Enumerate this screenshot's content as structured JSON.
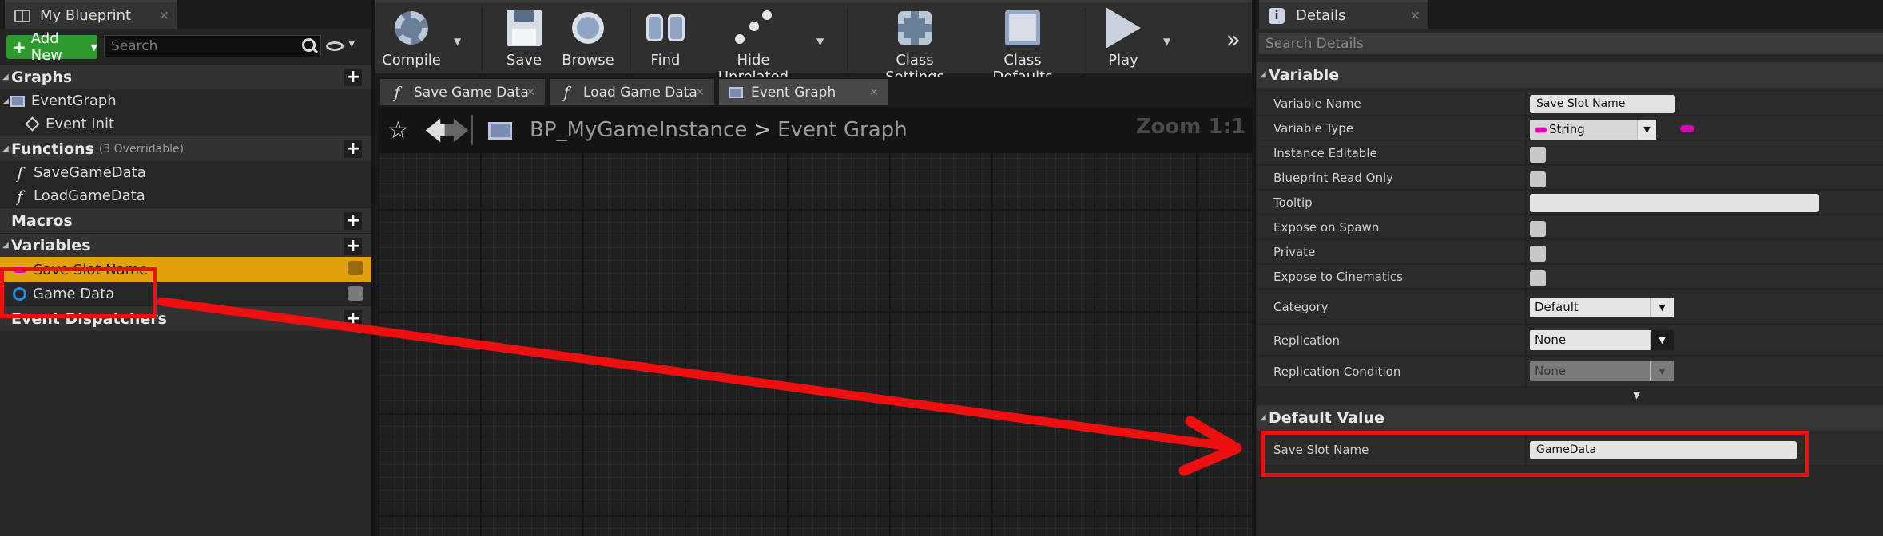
{
  "left_panel": {
    "tab_title": "My Blueprint",
    "add_new_label": "Add New",
    "search_placeholder": "Search",
    "sections": {
      "graphs": "Graphs",
      "functions": "Functions",
      "functions_note": "(3 Overridable)",
      "macros": "Macros",
      "variables": "Variables",
      "event_dispatchers": "Event Dispatchers"
    },
    "graph_items": [
      "EventGraph",
      "Event Init"
    ],
    "function_items": [
      "SaveGameData",
      "LoadGameData"
    ],
    "variable_items": [
      "Save Slot Name",
      "Game Data"
    ]
  },
  "toolbar": {
    "compile": "Compile",
    "save": "Save",
    "browse": "Browse",
    "find": "Find",
    "hide_unrelated": "Hide Unrelated",
    "class_settings": "Class Settings",
    "class_defaults": "Class Defaults",
    "play": "Play"
  },
  "graph_tabs": [
    "Save Game Data",
    "Load Game Data",
    "Event Graph"
  ],
  "breadcrumb": {
    "blueprint": "BP_MyGameInstance",
    "separator": ">",
    "graph": "Event Graph",
    "zoom": "Zoom 1:1"
  },
  "details": {
    "tab_title": "Details",
    "search_placeholder": "Search Details",
    "variable_section": "Variable",
    "rows": {
      "variable_name_label": "Variable Name",
      "variable_name_value": "Save Slot Name",
      "variable_type_label": "Variable Type",
      "variable_type_value": "String",
      "instance_editable_label": "Instance Editable",
      "blueprint_read_only_label": "Blueprint Read Only",
      "tooltip_label": "Tooltip",
      "tooltip_value": "",
      "expose_on_spawn_label": "Expose on Spawn",
      "private_label": "Private",
      "expose_to_cinematics_label": "Expose to Cinematics",
      "category_label": "Category",
      "category_value": "Default",
      "replication_label": "Replication",
      "replication_value": "None",
      "replication_condition_label": "Replication Condition",
      "replication_condition_value": "None"
    },
    "default_section": "Default Value",
    "default_row_label": "Save Slot Name",
    "default_row_value": "GameData"
  },
  "colors": {
    "selection": "#e2a10b",
    "string_pin": "#e000b0",
    "object_pin": "#1d8fe8",
    "annotation": "#ee1010",
    "add_button": "#2e9a2e"
  }
}
